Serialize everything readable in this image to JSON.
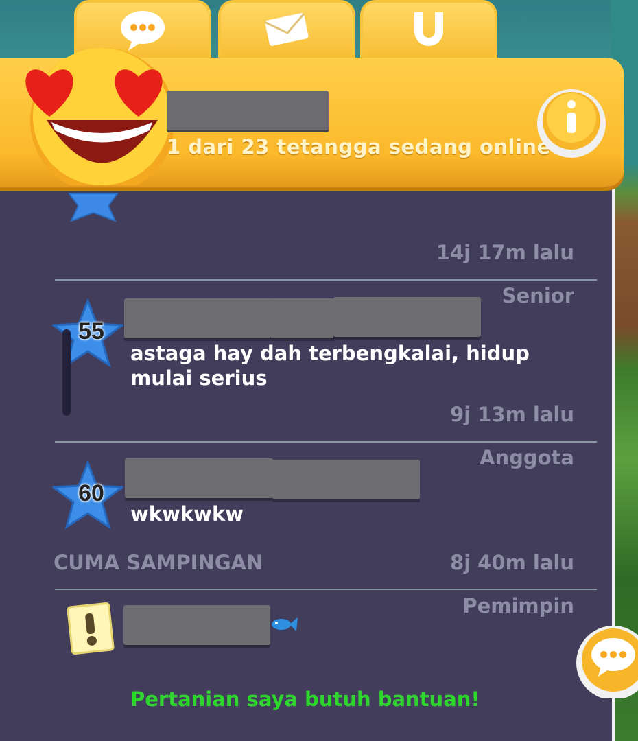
{
  "tabs": [
    {
      "name": "chat",
      "icon": "chat-bubble-icon"
    },
    {
      "name": "mail",
      "icon": "envelope-icon"
    },
    {
      "name": "neighborhood",
      "icon": "horseshoe-icon"
    }
  ],
  "header": {
    "online_status": "1 dari 23 tetangga sedang online",
    "avatar_icon": "heart-eyes-emoji-icon",
    "info_icon": "info-icon"
  },
  "messages": [
    {
      "time": "14j  17m lalu"
    },
    {
      "role": "Senior",
      "level": "55",
      "text_line1": "astaga hay dah terbengkalai, hidup",
      "text_line2": "mulai serius",
      "time": "9j  13m lalu"
    },
    {
      "role": "Anggota",
      "level": "60",
      "text": "wkwkwkw",
      "group": "CUMA SAMPINGAN",
      "time": "8j  40m lalu"
    },
    {
      "role": "Pemimpin",
      "help": "Pertanian saya butuh bantuan!"
    }
  ],
  "colors": {
    "panel": "#433d5c",
    "header": "#fbb92b",
    "help_text": "#2ed62e",
    "muted_text": "#8d8ea6"
  }
}
